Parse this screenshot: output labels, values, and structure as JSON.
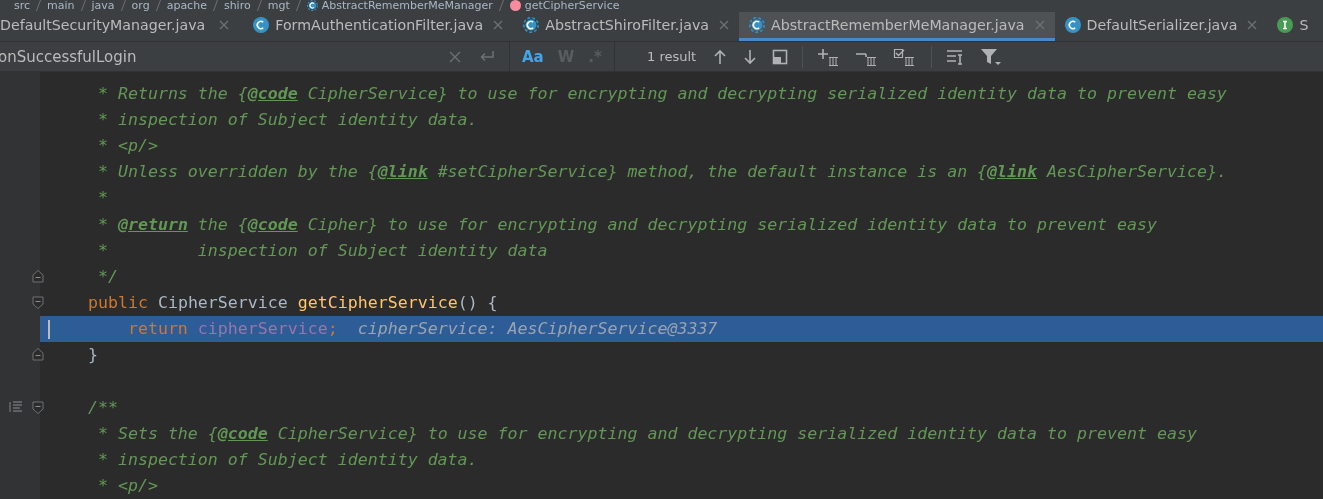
{
  "breadcrumb": [
    {
      "label": "src",
      "kind": "folder"
    },
    {
      "label": "main",
      "kind": "folder"
    },
    {
      "label": "java",
      "kind": "folder"
    },
    {
      "label": "org",
      "kind": "folder"
    },
    {
      "label": "apache",
      "kind": "folder"
    },
    {
      "label": "shiro",
      "kind": "folder"
    },
    {
      "label": "mgt",
      "kind": "folder"
    },
    {
      "label": "AbstractRememberMeManager",
      "kind": "abstract"
    },
    {
      "label": "getCipherService",
      "kind": "method"
    }
  ],
  "tabs": [
    {
      "label": "DefaultSecurityManager.java",
      "kind": "cut",
      "selected": false
    },
    {
      "label": "FormAuthenticationFilter.java",
      "kind": "class",
      "selected": false
    },
    {
      "label": "AbstractShiroFilter.java",
      "kind": "abstract",
      "selected": false
    },
    {
      "label": "AbstractRememberMeManager.java",
      "kind": "abstract",
      "selected": true
    },
    {
      "label": "DefaultSerializer.java",
      "kind": "class",
      "selected": false
    },
    {
      "label": "S",
      "kind": "interface",
      "selected": false
    }
  ],
  "search": {
    "value": "onSuccessfulLogin",
    "options": [
      {
        "label": "Aa",
        "selected": true
      },
      {
        "label": "W",
        "selected": false
      },
      {
        "label": ".*",
        "selected": false
      }
    ],
    "result": "1 result"
  },
  "code": [
    {
      "kind": "text",
      "current": false,
      "tokens": [
        {
          "kind": "comment",
          "text": "     * Returns the {"
        },
        {
          "kind": "doc_tag",
          "text": "@code"
        },
        {
          "kind": "comment",
          "text": " CipherService} to use for encrypting and decrypting serialized identity data to prevent easy"
        }
      ]
    },
    {
      "kind": "text",
      "current": false,
      "tokens": [
        {
          "kind": "comment",
          "text": "     * inspection of Subject identity data."
        }
      ]
    },
    {
      "kind": "text",
      "current": false,
      "tokens": [
        {
          "kind": "comment",
          "text": "     * <p/>"
        }
      ]
    },
    {
      "kind": "text",
      "current": false,
      "tokens": [
        {
          "kind": "comment",
          "text": "     * Unless overridden by the {"
        },
        {
          "kind": "doc_tag",
          "text": "@link"
        },
        {
          "kind": "comment",
          "text": " #setCipherService} method, the default instance is an {"
        },
        {
          "kind": "doc_tag",
          "text": "@link"
        },
        {
          "kind": "comment",
          "text": " AesCipherService}."
        }
      ]
    },
    {
      "kind": "text",
      "current": false,
      "tokens": [
        {
          "kind": "comment",
          "text": "     *"
        }
      ]
    },
    {
      "kind": "text",
      "current": false,
      "tokens": [
        {
          "kind": "comment",
          "text": "     * "
        },
        {
          "kind": "doc_tag",
          "text": "@return"
        },
        {
          "kind": "comment",
          "text": " the {"
        },
        {
          "kind": "doc_tag",
          "text": "@code"
        },
        {
          "kind": "comment",
          "text": " Cipher} to use for encrypting and decrypting serialized identity data to prevent easy"
        }
      ]
    },
    {
      "kind": "text",
      "current": false,
      "tokens": [
        {
          "kind": "comment",
          "text": "     *         inspection of Subject identity data"
        }
      ]
    },
    {
      "kind": "fold_end",
      "current": false,
      "tokens": [
        {
          "kind": "comment",
          "text": "     */"
        }
      ]
    },
    {
      "kind": "fold_start",
      "current": false,
      "tokens": [
        {
          "kind": "keyword",
          "text": "    public "
        },
        {
          "kind": "plain",
          "text": "CipherService "
        },
        {
          "kind": "method",
          "text": "getCipherService"
        },
        {
          "kind": "plain",
          "text": "() {"
        }
      ]
    },
    {
      "kind": "text",
      "current": true,
      "tokens": [
        {
          "kind": "keyword",
          "text": "        return "
        },
        {
          "kind": "field",
          "text": "cipherService"
        },
        {
          "kind": "keyword",
          "text": ";"
        },
        {
          "kind": "hint",
          "text": "  cipherService: AesCipherService@3337"
        }
      ]
    },
    {
      "kind": "fold_end",
      "current": false,
      "tokens": [
        {
          "kind": "plain",
          "text": "    }"
        }
      ]
    },
    {
      "kind": "blank"
    },
    {
      "kind": "doc_fold_start",
      "current": false,
      "tokens": [
        {
          "kind": "comment",
          "text": "    /**"
        }
      ]
    },
    {
      "kind": "text",
      "current": false,
      "tokens": [
        {
          "kind": "comment",
          "text": "     * Sets the {"
        },
        {
          "kind": "doc_tag",
          "text": "@code"
        },
        {
          "kind": "comment",
          "text": " CipherService} to use for encrypting and decrypting serialized identity data to prevent easy"
        }
      ]
    },
    {
      "kind": "text",
      "current": false,
      "tokens": [
        {
          "kind": "comment",
          "text": "     * inspection of Subject identity data."
        }
      ]
    },
    {
      "kind": "text",
      "current": false,
      "tokens": [
        {
          "kind": "comment",
          "text": "     * <p/>"
        }
      ]
    }
  ]
}
